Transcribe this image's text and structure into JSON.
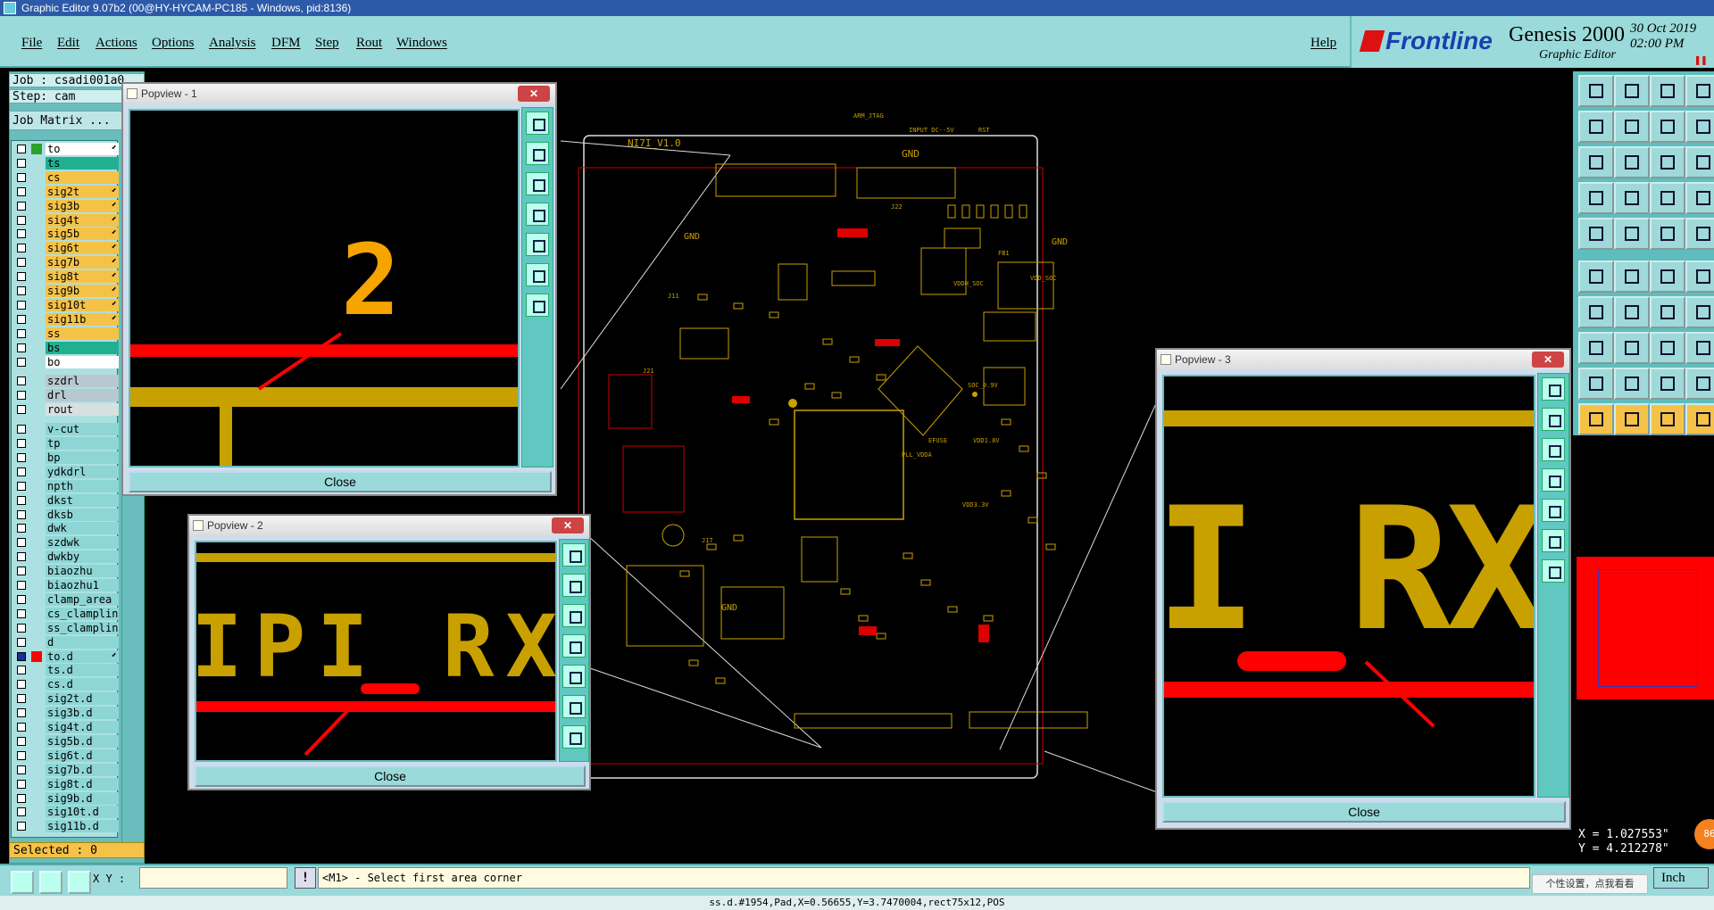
{
  "window": {
    "title": "Graphic Editor 9.07b2 (00@HY-HYCAM-PC185 - Windows, pid:8136)"
  },
  "menu": [
    "File",
    "Edit",
    "Actions",
    "Options",
    "Analysis",
    "DFM",
    "Step",
    "Rout",
    "Windows"
  ],
  "help": "Help",
  "brand": {
    "logo": "Frontline",
    "product": "Genesis 2000",
    "subtitle": "Graphic Editor",
    "date": "30 Oct 2019",
    "time": "02:00 PM",
    "accent": "#1a3fb0"
  },
  "left": {
    "job": "Job : csadi001a0",
    "step": "Step: cam",
    "matrix": "Job Matrix ..."
  },
  "layers": [
    {
      "name": "to",
      "color": "#ffffff",
      "swatch": "#2ca02c",
      "arrow": true
    },
    {
      "name": "ts",
      "color": "#20b090",
      "swatch": "",
      "arrow": false
    },
    {
      "name": "cs",
      "color": "#f5c248",
      "swatch": "",
      "arrow": false
    },
    {
      "name": "sig2t",
      "color": "#f5c248",
      "swatch": "",
      "arrow": true
    },
    {
      "name": "sig3b",
      "color": "#f5c248",
      "swatch": "",
      "arrow": true
    },
    {
      "name": "sig4t",
      "color": "#f5c248",
      "swatch": "",
      "arrow": true
    },
    {
      "name": "sig5b",
      "color": "#f5c248",
      "swatch": "",
      "arrow": true
    },
    {
      "name": "sig6t",
      "color": "#f5c248",
      "swatch": "",
      "arrow": true
    },
    {
      "name": "sig7b",
      "color": "#f5c248",
      "swatch": "",
      "arrow": true
    },
    {
      "name": "sig8t",
      "color": "#f5c248",
      "swatch": "",
      "arrow": true
    },
    {
      "name": "sig9b",
      "color": "#f5c248",
      "swatch": "",
      "arrow": true
    },
    {
      "name": "sig10t",
      "color": "#f5c248",
      "swatch": "",
      "arrow": true
    },
    {
      "name": "sig11b",
      "color": "#f5c248",
      "swatch": "",
      "arrow": true
    },
    {
      "name": "ss",
      "color": "#f5c248",
      "swatch": "",
      "arrow": false
    },
    {
      "name": "bs",
      "color": "#20b090",
      "swatch": "",
      "arrow": false
    },
    {
      "name": "bo",
      "color": "#ffffff",
      "swatch": "",
      "arrow": false
    },
    {
      "name": "",
      "color": "#ade0e0",
      "swatch": "",
      "arrow": false,
      "gap": true
    },
    {
      "name": "szdrl",
      "color": "#b8c8d0",
      "swatch": "",
      "arrow": false
    },
    {
      "name": "drl",
      "color": "#b8c8d0",
      "swatch": "",
      "arrow": false
    },
    {
      "name": "rout",
      "color": "#d8e0e0",
      "swatch": "",
      "arrow": false
    },
    {
      "name": "",
      "color": "#ade0e0",
      "swatch": "",
      "arrow": false,
      "gap": true
    },
    {
      "name": "v-cut",
      "color": "#8ed6d6",
      "swatch": "",
      "arrow": false
    },
    {
      "name": "tp",
      "color": "#8ed6d6",
      "swatch": "",
      "arrow": false
    },
    {
      "name": "bp",
      "color": "#8ed6d6",
      "swatch": "",
      "arrow": false
    },
    {
      "name": "ydkdrl",
      "color": "#8ed6d6",
      "swatch": "",
      "arrow": false
    },
    {
      "name": "npth",
      "color": "#8ed6d6",
      "swatch": "",
      "arrow": false
    },
    {
      "name": "dkst",
      "color": "#8ed6d6",
      "swatch": "",
      "arrow": false
    },
    {
      "name": "dksb",
      "color": "#8ed6d6",
      "swatch": "",
      "arrow": false
    },
    {
      "name": "dwk",
      "color": "#8ed6d6",
      "swatch": "",
      "arrow": false
    },
    {
      "name": "szdwk",
      "color": "#8ed6d6",
      "swatch": "",
      "arrow": false
    },
    {
      "name": "dwkby",
      "color": "#8ed6d6",
      "swatch": "",
      "arrow": false
    },
    {
      "name": "biaozhu",
      "color": "#8ed6d6",
      "swatch": "",
      "arrow": false
    },
    {
      "name": "biaozhu1",
      "color": "#8ed6d6",
      "swatch": "",
      "arrow": false
    },
    {
      "name": "clamp_area",
      "color": "#8ed6d6",
      "swatch": "",
      "arrow": false
    },
    {
      "name": "cs_clampline",
      "color": "#8ed6d6",
      "swatch": "",
      "arrow": false
    },
    {
      "name": "ss_clampline",
      "color": "#8ed6d6",
      "swatch": "",
      "arrow": false
    },
    {
      "name": "d",
      "color": "#8ed6d6",
      "swatch": "",
      "arrow": false
    },
    {
      "name": "to.d",
      "color": "#8ed6d6",
      "swatch": "#ff0000",
      "arrow": true,
      "checked": true
    },
    {
      "name": "ts.d",
      "color": "#8ed6d6",
      "swatch": "",
      "arrow": false
    },
    {
      "name": "cs.d",
      "color": "#8ed6d6",
      "swatch": "",
      "arrow": false
    },
    {
      "name": "sig2t.d",
      "color": "#8ed6d6",
      "swatch": "",
      "arrow": false
    },
    {
      "name": "sig3b.d",
      "color": "#8ed6d6",
      "swatch": "",
      "arrow": false
    },
    {
      "name": "sig4t.d",
      "color": "#8ed6d6",
      "swatch": "",
      "arrow": false
    },
    {
      "name": "sig5b.d",
      "color": "#8ed6d6",
      "swatch": "",
      "arrow": false
    },
    {
      "name": "sig6t.d",
      "color": "#8ed6d6",
      "swatch": "",
      "arrow": false
    },
    {
      "name": "sig7b.d",
      "color": "#8ed6d6",
      "swatch": "",
      "arrow": false
    },
    {
      "name": "sig8t.d",
      "color": "#8ed6d6",
      "swatch": "",
      "arrow": false
    },
    {
      "name": "sig9b.d",
      "color": "#8ed6d6",
      "swatch": "",
      "arrow": false
    },
    {
      "name": "sig10t.d",
      "color": "#8ed6d6",
      "swatch": "",
      "arrow": false
    },
    {
      "name": "sig11b.d",
      "color": "#8ed6d6",
      "swatch": "",
      "arrow": false
    }
  ],
  "selected": "Selected : 0",
  "popviews": [
    {
      "title": "Popview - 1",
      "close": "Close",
      "view_text": "2"
    },
    {
      "title": "Popview - 2",
      "close": "Close",
      "view_text": "IPI RX"
    },
    {
      "title": "Popview - 3",
      "close": "Close",
      "view_text": "I RX"
    }
  ],
  "board": {
    "title": "NI7I_V1.0",
    "labels": [
      "GND",
      "GND",
      "GND",
      "GND",
      "ARM_JTAG",
      "INPUT DC--5V",
      "RST",
      "VDD_SOC",
      "VDDH_SOC",
      "EFUSE",
      "PLL_VDDA",
      "VDD1.8V",
      "SOC_0.9V",
      "VDD3.3V",
      "FB1",
      "J11",
      "J17",
      "J21",
      "J22"
    ]
  },
  "coords": {
    "x": "X = 1.027553\"",
    "y": "Y = 4.212278\""
  },
  "bottom": {
    "xy_label": "X Y :",
    "xy_value": "",
    "warn": "!",
    "prompt": "<M1> - Select first area corner",
    "tooltip": "个性设置，点我看看",
    "unit": "Inch",
    "status": "ss.d.#1954,Pad,X=0.56655,Y=3.7470004,rect75x12,POS",
    "badge": "86"
  },
  "colors": {
    "panel": "#9adada",
    "copper": "#c8a000",
    "highlight": "#ff0000"
  }
}
